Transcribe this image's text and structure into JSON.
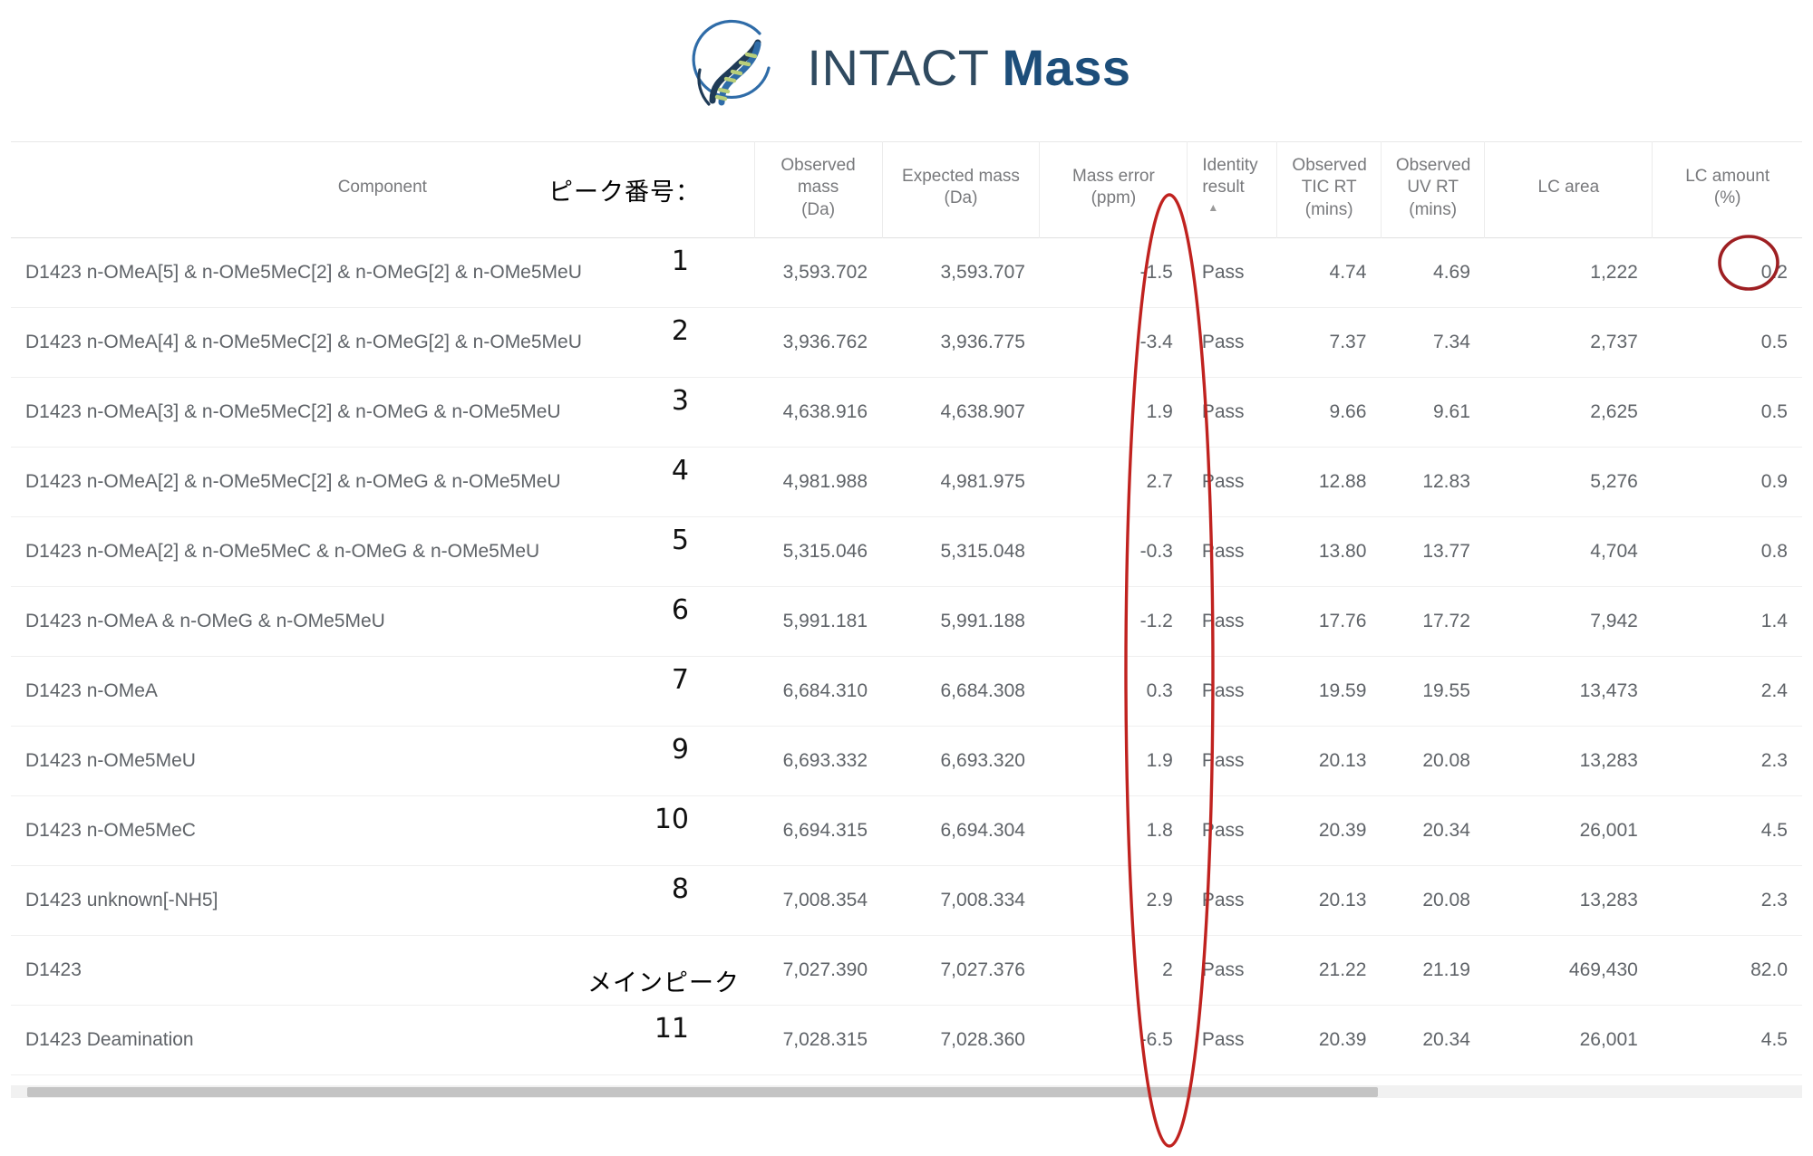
{
  "brand": {
    "logo_icon": "dna-helix-circle-icon",
    "name_light": "INTACT",
    "name_bold": "Mass"
  },
  "table": {
    "columns": [
      {
        "id": "component",
        "label": "Component",
        "unit": "",
        "sorted": false
      },
      {
        "id": "obs_mass",
        "label": "Observed mass",
        "unit": "(Da)",
        "sorted": false
      },
      {
        "id": "exp_mass",
        "label": "Expected mass",
        "unit": "(Da)",
        "sorted": false
      },
      {
        "id": "mass_error",
        "label": "Mass error",
        "unit": "(ppm)",
        "sorted": false
      },
      {
        "id": "identity",
        "label": "Identity result",
        "unit": "",
        "sorted": true,
        "sort_glyph": "▲"
      },
      {
        "id": "tic_rt",
        "label": "Observed TIC RT",
        "unit": "(mins)",
        "sorted": false
      },
      {
        "id": "uv_rt",
        "label": "Observed UV RT",
        "unit": "(mins)",
        "sorted": false
      },
      {
        "id": "lc_area",
        "label": "LC area",
        "unit": "",
        "sorted": false
      },
      {
        "id": "lc_amount",
        "label": "LC amount",
        "unit": "(%)",
        "sorted": false
      }
    ],
    "header_lines": {
      "component": [
        "Component"
      ],
      "obs_mass": [
        "Observed mass",
        "(Da)"
      ],
      "exp_mass": [
        "Expected mass",
        "(Da)"
      ],
      "mass_error": [
        "Mass error",
        "(ppm)"
      ],
      "identity": [
        "Identity",
        "result"
      ],
      "tic_rt": [
        "Observed",
        "TIC RT",
        "(mins)"
      ],
      "uv_rt": [
        "Observed",
        "UV RT",
        "(mins)"
      ],
      "lc_area": [
        "LC area"
      ],
      "lc_amount": [
        "LC amount",
        "(%)"
      ]
    },
    "rows": [
      {
        "component": "D1423 n-OMeA[5] & n-OMe5MeC[2] & n-OMeG[2] & n-OMe5MeU",
        "obs_mass": "3,593.702",
        "exp_mass": "3,593.707",
        "mass_error": "-1.5",
        "identity": "Pass",
        "tic_rt": "4.74",
        "uv_rt": "4.69",
        "lc_area": "1,222",
        "lc_amount": "0.2",
        "peak_number": "1"
      },
      {
        "component": "D1423 n-OMeA[4] & n-OMe5MeC[2] & n-OMeG[2] & n-OMe5MeU",
        "obs_mass": "3,936.762",
        "exp_mass": "3,936.775",
        "mass_error": "-3.4",
        "identity": "Pass",
        "tic_rt": "7.37",
        "uv_rt": "7.34",
        "lc_area": "2,737",
        "lc_amount": "0.5",
        "peak_number": "2"
      },
      {
        "component": "D1423 n-OMeA[3] & n-OMe5MeC[2] & n-OMeG & n-OMe5MeU",
        "obs_mass": "4,638.916",
        "exp_mass": "4,638.907",
        "mass_error": "1.9",
        "identity": "Pass",
        "tic_rt": "9.66",
        "uv_rt": "9.61",
        "lc_area": "2,625",
        "lc_amount": "0.5",
        "peak_number": "3"
      },
      {
        "component": "D1423 n-OMeA[2] & n-OMe5MeC[2] & n-OMeG & n-OMe5MeU",
        "obs_mass": "4,981.988",
        "exp_mass": "4,981.975",
        "mass_error": "2.7",
        "identity": "Pass",
        "tic_rt": "12.88",
        "uv_rt": "12.83",
        "lc_area": "5,276",
        "lc_amount": "0.9",
        "peak_number": "4"
      },
      {
        "component": "D1423 n-OMeA[2] & n-OMe5MeC & n-OMeG & n-OMe5MeU",
        "obs_mass": "5,315.046",
        "exp_mass": "5,315.048",
        "mass_error": "-0.3",
        "identity": "Pass",
        "tic_rt": "13.80",
        "uv_rt": "13.77",
        "lc_area": "4,704",
        "lc_amount": "0.8",
        "peak_number": "5"
      },
      {
        "component": "D1423 n-OMeA & n-OMeG & n-OMe5MeU",
        "obs_mass": "5,991.181",
        "exp_mass": "5,991.188",
        "mass_error": "-1.2",
        "identity": "Pass",
        "tic_rt": "17.76",
        "uv_rt": "17.72",
        "lc_area": "7,942",
        "lc_amount": "1.4",
        "peak_number": "6"
      },
      {
        "component": "D1423 n-OMeA",
        "obs_mass": "6,684.310",
        "exp_mass": "6,684.308",
        "mass_error": "0.3",
        "identity": "Pass",
        "tic_rt": "19.59",
        "uv_rt": "19.55",
        "lc_area": "13,473",
        "lc_amount": "2.4",
        "peak_number": "7"
      },
      {
        "component": "D1423 n-OMe5MeU",
        "obs_mass": "6,693.332",
        "exp_mass": "6,693.320",
        "mass_error": "1.9",
        "identity": "Pass",
        "tic_rt": "20.13",
        "uv_rt": "20.08",
        "lc_area": "13,283",
        "lc_amount": "2.3",
        "peak_number": "9"
      },
      {
        "component": "D1423 n-OMe5MeC",
        "obs_mass": "6,694.315",
        "exp_mass": "6,694.304",
        "mass_error": "1.8",
        "identity": "Pass",
        "tic_rt": "20.39",
        "uv_rt": "20.34",
        "lc_area": "26,001",
        "lc_amount": "4.5",
        "peak_number": "10"
      },
      {
        "component": "D1423 unknown[-NH5]",
        "obs_mass": "7,008.354",
        "exp_mass": "7,008.334",
        "mass_error": "2.9",
        "identity": "Pass",
        "tic_rt": "20.13",
        "uv_rt": "20.08",
        "lc_area": "13,283",
        "lc_amount": "2.3",
        "peak_number": "8"
      },
      {
        "component": "D1423",
        "obs_mass": "7,027.390",
        "exp_mass": "7,027.376",
        "mass_error": "2",
        "identity": "Pass",
        "tic_rt": "21.22",
        "uv_rt": "21.19",
        "lc_area": "469,430",
        "lc_amount": "82.0",
        "peak_number": ""
      },
      {
        "component": "D1423 Deamination",
        "obs_mass": "7,028.315",
        "exp_mass": "7,028.360",
        "mass_error": "-6.5",
        "identity": "Pass",
        "tic_rt": "20.39",
        "uv_rt": "20.34",
        "lc_area": "26,001",
        "lc_amount": "4.5",
        "peak_number": "11"
      }
    ]
  },
  "annotations": {
    "peak_number_label": "ピーク番号：",
    "main_peak_label": "メインピーク",
    "ink_color": "#c0221f",
    "circle_target_value": "0.2",
    "ellipse_target_column": "Mass error (ppm)"
  }
}
